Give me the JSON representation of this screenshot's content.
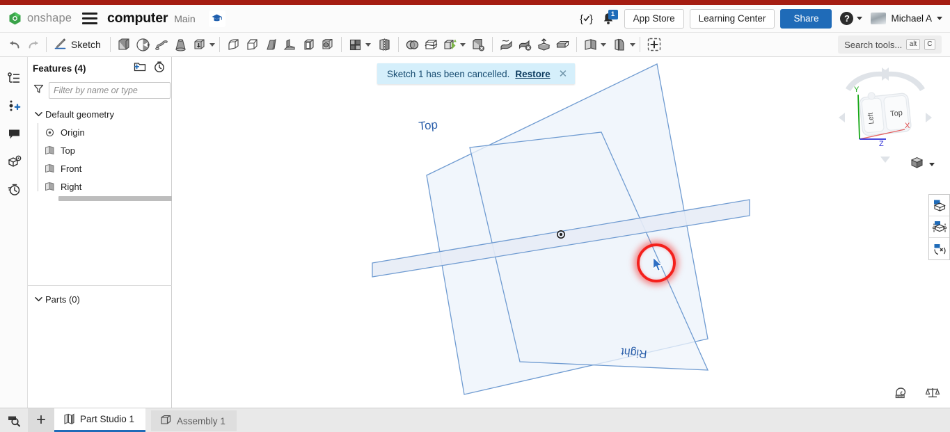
{
  "header": {
    "logo_text": "onshape",
    "logo_icon": "onshape-logo-icon",
    "menu_icon": "hamburger-menu-icon",
    "document_title": "computer",
    "branch": "Main",
    "graduation_icon": "graduation-cap-icon",
    "versions_icon": "versions-braces-icon",
    "notifications_icon": "bell-icon",
    "notification_count": "1",
    "app_store_label": "App Store",
    "learning_center_label": "Learning Center",
    "share_label": "Share",
    "help_icon": "help-question-icon",
    "avatar_icon": "user-avatar",
    "user_name": "Michael A",
    "accent_blue": "#1f6bb8",
    "brand_red": "#a51d12"
  },
  "toolbar": {
    "undo_icon": "undo-arrow-icon",
    "redo_icon": "redo-arrow-icon",
    "sketch_icon": "sketch-pencil-icon",
    "sketch_label": "Sketch",
    "items": [
      {
        "name": "extrude-icon"
      },
      {
        "name": "revolve-icon"
      },
      {
        "name": "sweep-icon"
      },
      {
        "name": "loft-icon"
      },
      {
        "name": "thicken-icon"
      },
      {
        "name": "fillet-icon"
      },
      {
        "name": "chamfer-icon"
      },
      {
        "name": "draft-icon"
      },
      {
        "name": "rib-icon"
      },
      {
        "name": "shell-icon"
      },
      {
        "name": "hole-icon"
      },
      {
        "name": "pattern-icon"
      },
      {
        "name": "mirror-icon"
      },
      {
        "name": "boolean-icon"
      },
      {
        "name": "split-icon"
      },
      {
        "name": "transform-icon"
      },
      {
        "name": "delete-face-icon"
      },
      {
        "name": "move-face-icon"
      },
      {
        "name": "delete-part-icon"
      },
      {
        "name": "import-derive-icon"
      },
      {
        "name": "enclose-icon"
      },
      {
        "name": "plane-icon"
      },
      {
        "name": "sheet-metal-icon"
      },
      {
        "name": "add-custom-feature-icon"
      }
    ],
    "search_tools_label": "Search tools...",
    "shortcut_alt": "alt",
    "shortcut_key": "C"
  },
  "rail": {
    "items": [
      {
        "name": "feature-list-icon"
      },
      {
        "name": "add-collaborator-icon"
      },
      {
        "name": "comments-icon"
      },
      {
        "name": "part-properties-icon"
      },
      {
        "name": "history-icon"
      }
    ]
  },
  "features_panel": {
    "title": "Features (4)",
    "new_folder_icon": "new-folder-icon",
    "rollback_icon": "rollback-stopwatch-icon",
    "filter_icon": "filter-funnel-icon",
    "filter_placeholder": "Filter by name or type",
    "tree": {
      "group_label": "Default geometry",
      "group_chevron": "chevron-down-icon",
      "nodes": [
        {
          "label": "Origin",
          "icon": "origin-point-icon"
        },
        {
          "label": "Top",
          "icon": "plane-icon"
        },
        {
          "label": "Front",
          "icon": "plane-icon"
        },
        {
          "label": "Right",
          "icon": "plane-icon"
        }
      ]
    },
    "rollback_bar": "rollback-bar",
    "parts_label": "Parts (0)",
    "parts_chevron": "chevron-down-icon",
    "list_toggle_icon": "feature-list-toggle-icon"
  },
  "canvas": {
    "notice": {
      "message": "Sketch 1 has been cancelled.",
      "link_label": "Restore",
      "close_icon": "close-icon"
    },
    "planes": [
      {
        "label": "Top",
        "name": "top-plane"
      },
      {
        "label": "Right",
        "name": "right-plane"
      },
      {
        "label": "",
        "name": "front-plane"
      }
    ],
    "origin_marker": "origin-marker",
    "cursor": "mouse-cursor",
    "click_highlight": "click-highlight-ring",
    "plane_stroke": "#6f9bd1",
    "plane_fill": "#eff4fb",
    "label_color": "#2b5faa",
    "view_cube": {
      "name": "view-cube",
      "face_top": "Top",
      "face_left": "Left",
      "axis_x": "X",
      "axis_y": "Y",
      "axis_z": "Z",
      "axis_x_color": "#e04a4a",
      "axis_y_color": "#17a817",
      "axis_z_color": "#2b2bd8",
      "display_mode_icon": "display-style-cube-icon",
      "display_mode_caret": "chevron-down-icon",
      "arrow_up_icon": "arrow-up-icon",
      "arrow_down_icon": "arrow-down-icon",
      "arrow_left_icon": "arrow-left-icon",
      "arrow_right_icon": "arrow-right-icon",
      "rotate_ccw_icon": "rotate-ccw-icon",
      "rotate_cw_icon": "rotate-cw-icon"
    },
    "right_panel": [
      {
        "name": "display-states-icon"
      },
      {
        "name": "appearance-editor-icon"
      },
      {
        "name": "render-settings-icon"
      }
    ],
    "bottom_right": [
      {
        "name": "measure-tape-icon"
      },
      {
        "name": "mass-properties-scale-icon"
      }
    ]
  },
  "bottom_bar": {
    "search_icon": "search-tabs-icon",
    "add_tab_label": "+",
    "tabs": [
      {
        "label": "Part Studio 1",
        "icon": "part-studio-icon",
        "active": true
      },
      {
        "label": "Assembly 1",
        "icon": "assembly-icon",
        "active": false
      }
    ]
  }
}
